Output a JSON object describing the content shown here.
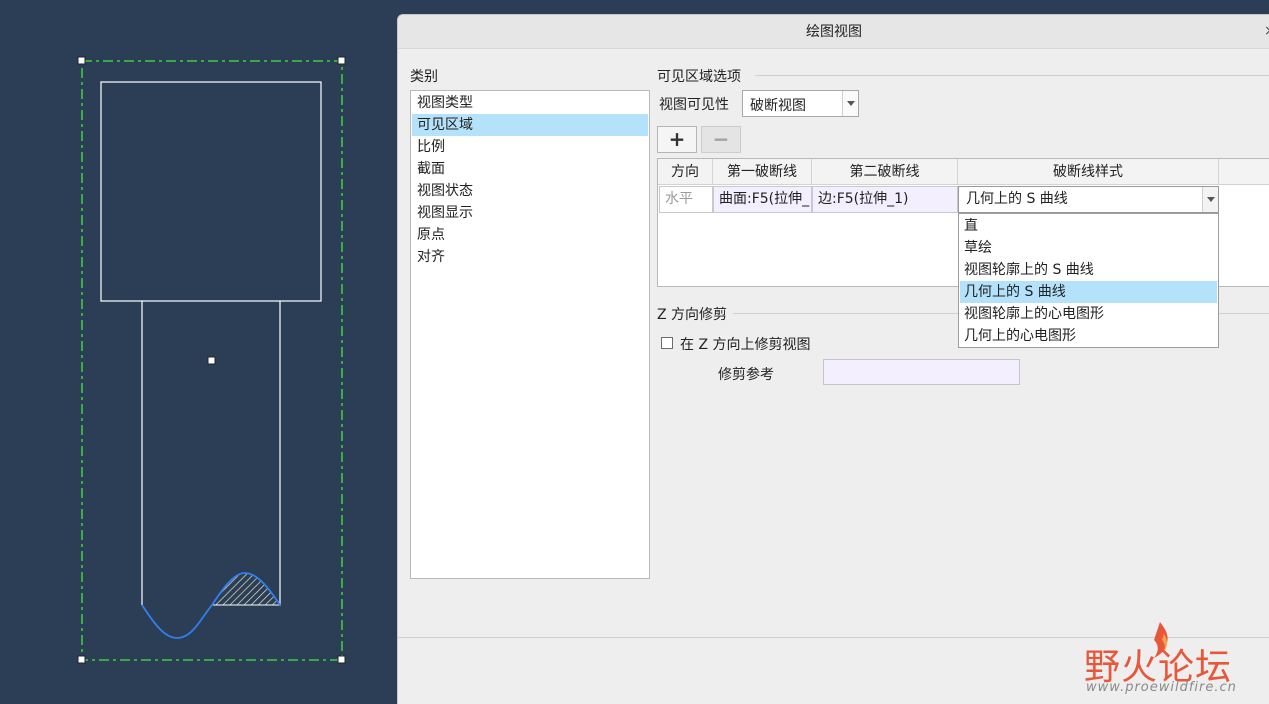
{
  "dialog": {
    "title": "绘图视图",
    "close_label": "×",
    "category_label": "类别",
    "categories": [
      "视图类型",
      "可见区域",
      "比例",
      "截面",
      "视图状态",
      "视图显示",
      "原点",
      "对齐"
    ],
    "selected_category": 1,
    "visible_area": {
      "group_label": "可见区域选项",
      "visibility_label": "视图可见性",
      "visibility_value": "破断视图",
      "add_icon": "plus-icon",
      "remove_icon": "minus-icon",
      "table": {
        "headers": [
          "方向",
          "第一破断线",
          "第二破断线",
          "破断线样式"
        ],
        "rows": [
          {
            "direction": "水平",
            "first_break": "曲面:F5(拉伸_",
            "second_break": "边:F5(拉伸_1)",
            "style": "几何上的 S 曲线"
          }
        ]
      },
      "style_options": [
        "直",
        "草绘",
        "视图轮廓上的 S 曲线",
        "几何上的 S 曲线",
        "视图轮廓上的心电图形",
        "几何上的心电图形"
      ],
      "selected_style_index": 3
    },
    "z_trim": {
      "group_label": "Z 方向修剪",
      "checkbox_label": "在 Z 方向上修剪视图",
      "checked": false,
      "trim_ref_label": "修剪参考",
      "trim_ref_value": ""
    }
  },
  "watermark": {
    "title": "野火论坛",
    "url": "www.proewildfire.cn"
  },
  "colors": {
    "canvas_bg": "#2c3e55",
    "selection_dash": "#3ccd3c",
    "break_curve": "#2f7ff0",
    "list_highlight": "#b5e2fb",
    "ref_field_bg": "#f3efff",
    "watermark": "#e8573a"
  }
}
